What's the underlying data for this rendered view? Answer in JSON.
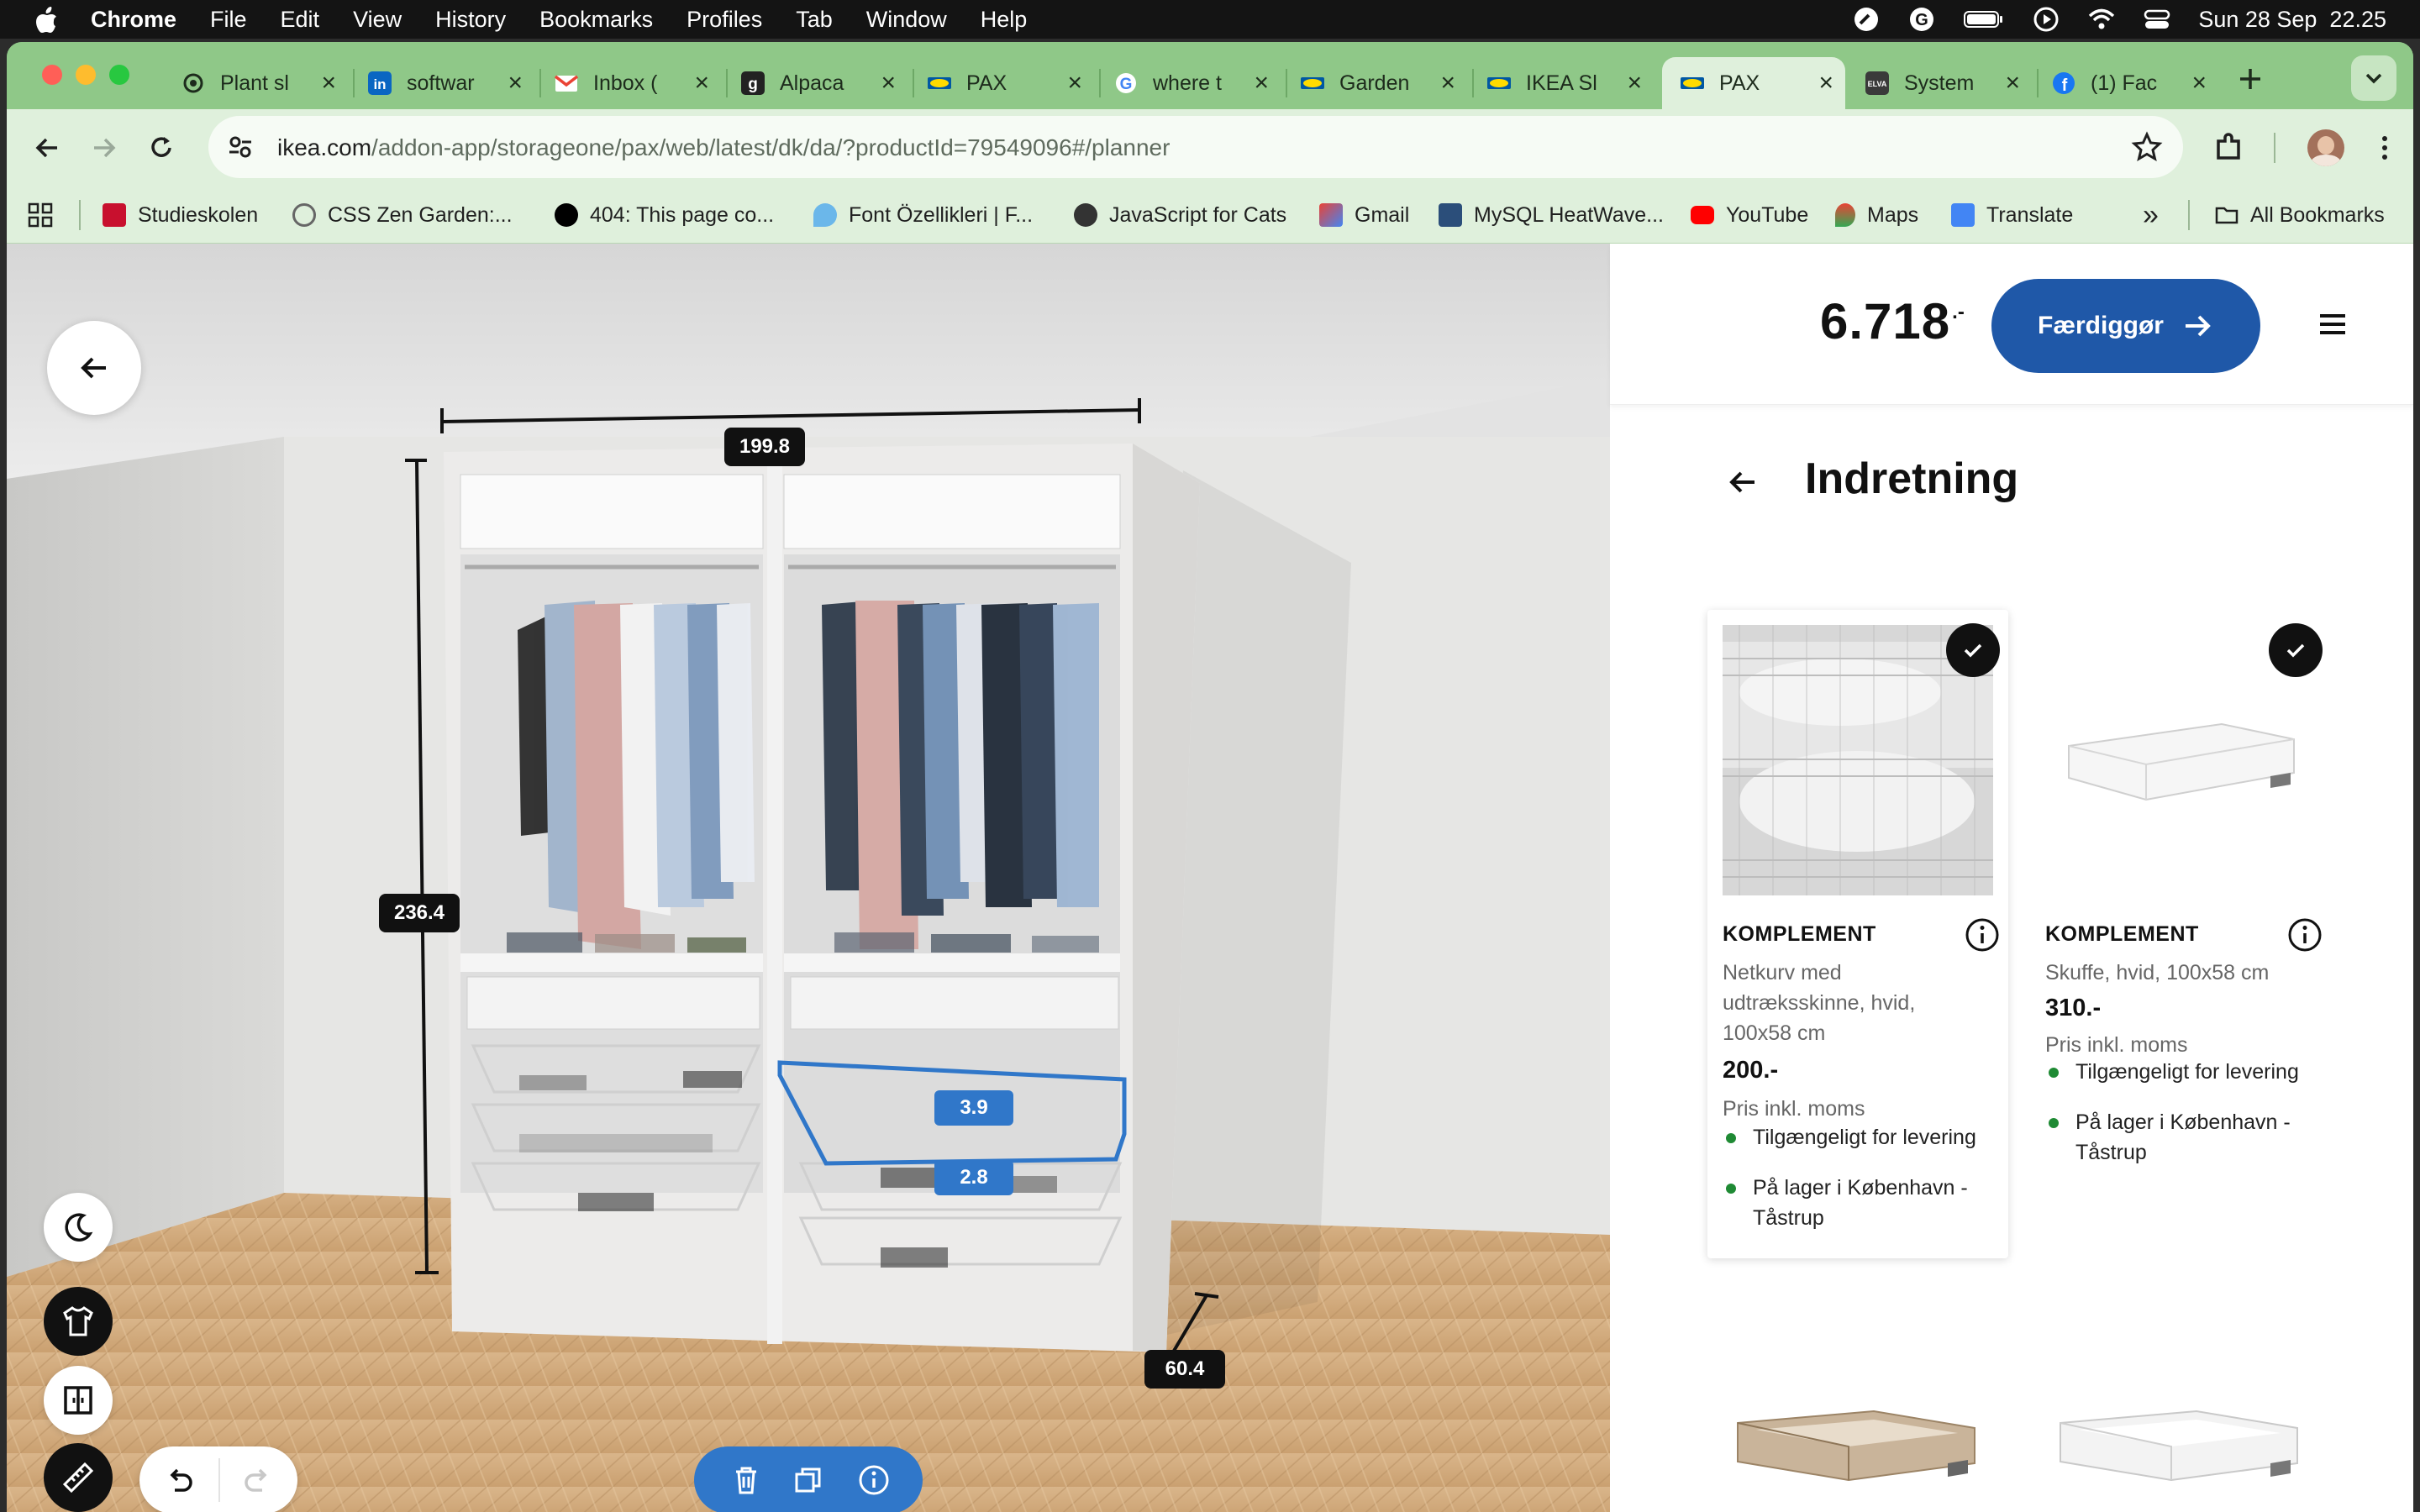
{
  "menubar": {
    "app": "Chrome",
    "items": [
      "File",
      "Edit",
      "View",
      "History",
      "Bookmarks",
      "Profiles",
      "Tab",
      "Window",
      "Help"
    ],
    "datetime": "Sun 28 Sep  22.25"
  },
  "tabs": [
    {
      "title": "Plant sl",
      "icon": "openai-icon"
    },
    {
      "title": "softwar",
      "icon": "linkedin-icon"
    },
    {
      "title": "Inbox (",
      "icon": "gmail-icon"
    },
    {
      "title": "Alpaca",
      "icon": "g-icon"
    },
    {
      "title": "PAX",
      "icon": "ikea-icon"
    },
    {
      "title": "where t",
      "icon": "google-icon"
    },
    {
      "title": "Garden",
      "icon": "ikea-icon"
    },
    {
      "title": "IKEA Sl",
      "icon": "ikea-icon"
    },
    {
      "title": "PAX",
      "icon": "ikea-icon",
      "active": true
    },
    {
      "title": "System",
      "icon": "elva-icon"
    },
    {
      "title": "(1) Fac",
      "icon": "facebook-icon"
    }
  ],
  "address": {
    "host": "ikea.com",
    "path": "/addon-app/storageone/pax/web/latest/dk/da/?productId=79549096#/planner"
  },
  "bookmarks": [
    {
      "label": "Studieskolen"
    },
    {
      "label": "CSS Zen Garden:..."
    },
    {
      "label": "404: This page co..."
    },
    {
      "label": "Font Özellikleri | F..."
    },
    {
      "label": "JavaScript for Cats"
    },
    {
      "label": "Gmail"
    },
    {
      "label": "MySQL HeatWave..."
    },
    {
      "label": "YouTube"
    },
    {
      "label": "Maps"
    },
    {
      "label": "Translate"
    }
  ],
  "bookmarks_overflow": "»",
  "all_bookmarks": "All Bookmarks",
  "planner": {
    "dimensions": {
      "width": "199.8",
      "height": "236.4",
      "depth": "60.4"
    },
    "selection": {
      "top_gap": "3.9",
      "bottom_gap": "2.8"
    }
  },
  "panel": {
    "price": "6.718",
    "price_suffix": ".-",
    "finish_button": "Færdiggør",
    "section_title": "Indretning",
    "products": [
      {
        "name": "KOMPLEMENT",
        "desc_lines": [
          "Netkurv med",
          "udtræksskinne, hvid,",
          "100x58 cm"
        ],
        "price": "200.-",
        "price_note": "Pris inkl. moms",
        "avail1": "Tilgængeligt for levering",
        "avail2_lines": [
          "På lager i København -",
          "Tåstrup"
        ],
        "selected": true
      },
      {
        "name": "KOMPLEMENT",
        "desc_lines": [
          "Skuffe, hvid, 100x58 cm"
        ],
        "price": "310.-",
        "price_note": "Pris inkl. moms",
        "avail1": "Tilgængeligt for levering",
        "avail2_lines": [
          "På lager i København -",
          "Tåstrup"
        ],
        "selected": true
      }
    ]
  }
}
